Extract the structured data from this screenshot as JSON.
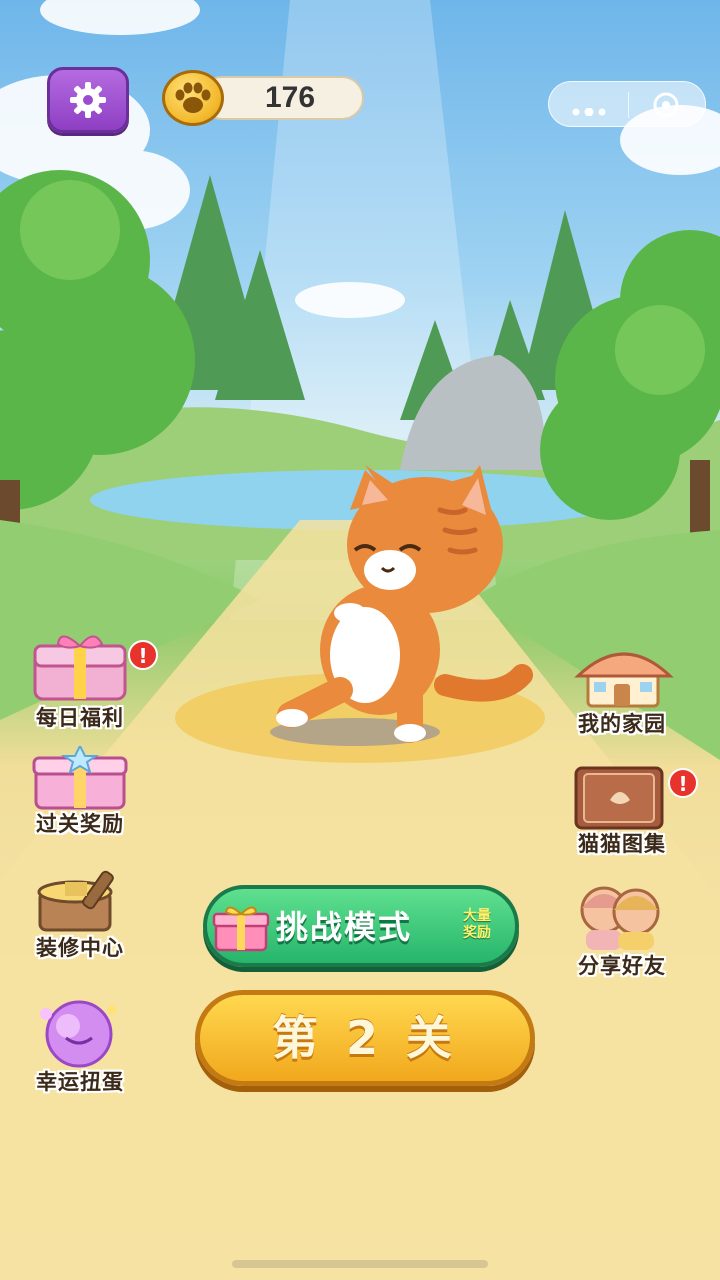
{
  "top_bar": {
    "coin_count": "176",
    "settings_icon": "gear-icon",
    "coin_icon": "paw-coin-icon",
    "capsule_more_icon": "more-dots-icon",
    "capsule_close_icon": "target-circle-icon"
  },
  "left_menu": [
    {
      "label": "每日福利",
      "icon": "gift-chest-icon",
      "alert": "!"
    },
    {
      "label": "过关奖励",
      "icon": "gift-box-icon"
    },
    {
      "label": "装修中心",
      "icon": "paint-bucket-icon"
    },
    {
      "label": "幸运扭蛋",
      "icon": "gacha-ball-icon"
    }
  ],
  "right_menu": [
    {
      "label": "我的家园",
      "icon": "house-icon"
    },
    {
      "label": "猫猫图集",
      "icon": "book-icon",
      "alert": "!"
    },
    {
      "label": "分享好友",
      "icon": "friends-icon"
    }
  ],
  "challenge_button": {
    "label": "挑战模式",
    "tag_line1": "大量",
    "tag_line2": "奖励",
    "icon": "gift-icon"
  },
  "level_button": {
    "label": "第 2 关"
  },
  "colors": {
    "sky": "#6fb6ea",
    "path": "#f7e5a8",
    "challenge_green": "#26b56b",
    "level_yellow": "#f1a81d",
    "settings_purple": "#8e3fc4",
    "alert_red": "#e8322c"
  }
}
